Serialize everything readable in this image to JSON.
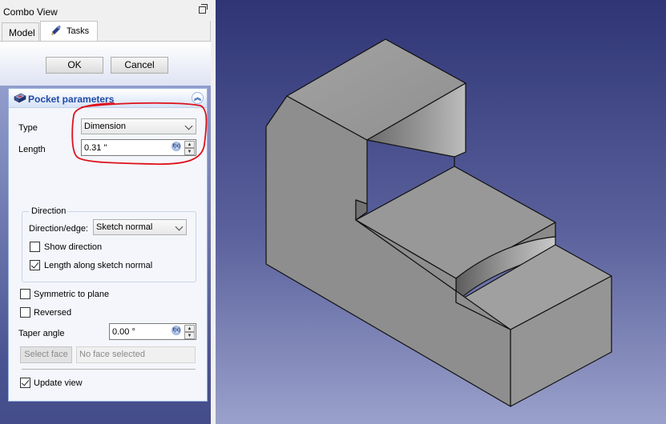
{
  "combo_view": {
    "title": "Combo View",
    "tabs": [
      {
        "label": "Model"
      },
      {
        "label": "Tasks"
      }
    ]
  },
  "task_buttons": {
    "ok": "OK",
    "cancel": "Cancel"
  },
  "pocket_parameters": {
    "title": "Pocket parameters",
    "type_label": "Type",
    "type_value": "Dimension",
    "length_label": "Length",
    "length_value": "0.31 \"",
    "direction": {
      "legend": "Direction",
      "edge_label": "Direction/edge:",
      "edge_value": "Sketch normal",
      "show_direction": {
        "label": "Show direction",
        "checked": false
      },
      "length_along_normal": {
        "label": "Length along sketch normal",
        "checked": true
      }
    },
    "symmetric": {
      "label": "Symmetric to plane",
      "checked": false
    },
    "reversed": {
      "label": "Reversed",
      "checked": false
    },
    "taper_label": "Taper angle",
    "taper_value": "0.00 °",
    "select_face_label": "Select face",
    "face_value": "No face selected",
    "update_view": {
      "label": "Update view",
      "checked": true
    }
  },
  "colors": {
    "viewport_top": "#2f3575",
    "viewport_bottom": "#9aa1cb",
    "accent_title": "#1f4aa8",
    "annotation": "#e0101a",
    "model_face_light": "#9a9a9a",
    "model_face_dark": "#6e6e6e"
  },
  "icons": {
    "pencil": "pencil-icon",
    "pocket": "pocket-icon",
    "collapse": "collapse-up-icon",
    "expression": "fx-icon",
    "float": "float-window-icon"
  }
}
